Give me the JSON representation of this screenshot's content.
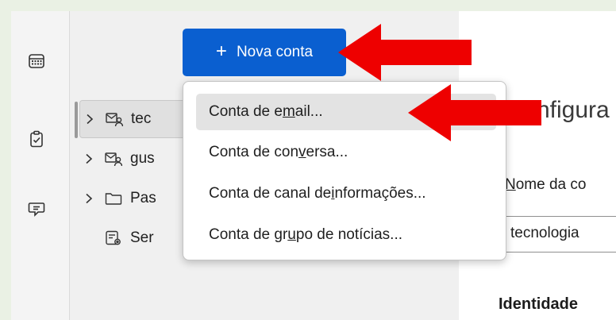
{
  "new_account_button": {
    "plus": "+",
    "label": "Nova conta"
  },
  "folder_tree": [
    {
      "label": "tec",
      "icon": "account-mail-icon",
      "expandable": true,
      "selected": true
    },
    {
      "label": "gus",
      "icon": "account-mail-icon",
      "expandable": true,
      "selected": false
    },
    {
      "label": "Pas",
      "icon": "folder-icon",
      "expandable": true,
      "selected": false
    },
    {
      "label": "Ser",
      "icon": "server-settings-icon",
      "expandable": false,
      "selected": false
    }
  ],
  "menu": {
    "items": [
      {
        "pre": "Conta de e",
        "accel": "m",
        "post": "ail..."
      },
      {
        "pre": "Conta de con",
        "accel": "v",
        "post": "ersa..."
      },
      {
        "pre": "Conta de canal de ",
        "accel": "i",
        "post": "nformações..."
      },
      {
        "pre": "Conta de gr",
        "accel": "u",
        "post": "po de notícias..."
      }
    ],
    "hovered_index": 0
  },
  "settings": {
    "title": "nfigura",
    "name_label_accel": "N",
    "name_label_rest": "ome da co",
    "name_value": "tecnologia",
    "identity_heading": "Identidade"
  },
  "spaces_toolbar": [
    "calendar-icon",
    "tasks-icon",
    "chat-icon"
  ],
  "colors": {
    "accent": "#0a5fd0",
    "annotation_arrow": "#ee0000",
    "menu_hover": "#e3e3e3"
  }
}
